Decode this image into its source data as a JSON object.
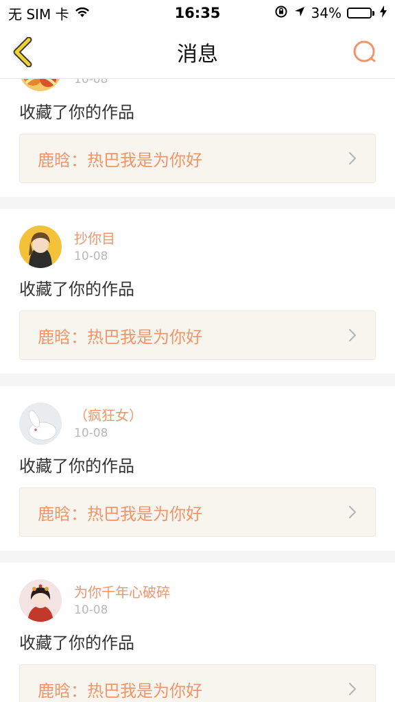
{
  "status_bar": {
    "carrier": "无 SIM 卡",
    "time": "16:35",
    "battery_pct_text": "34%",
    "battery_level": 0.34
  },
  "nav": {
    "title": "消息"
  },
  "colors": {
    "accent": "#f0956a",
    "card_bg": "#f7f5ee",
    "separator": "#f5f5f5"
  },
  "messages": [
    {
      "username": "",
      "time": "10-08",
      "action": "收藏了你的作品",
      "quote": "鹿晗：热巴我是为你好"
    },
    {
      "username": "抄你目",
      "time": "10-08",
      "action": "收藏了你的作品",
      "quote": "鹿晗：热巴我是为你好"
    },
    {
      "username": "（疯狂女）",
      "time": "10-08",
      "action": "收藏了你的作品",
      "quote": "鹿晗：热巴我是为你好"
    },
    {
      "username": "为你千年心破碎",
      "time": "10-08",
      "action": "收藏了你的作品",
      "quote": "鹿晗：热巴我是为你好"
    }
  ]
}
